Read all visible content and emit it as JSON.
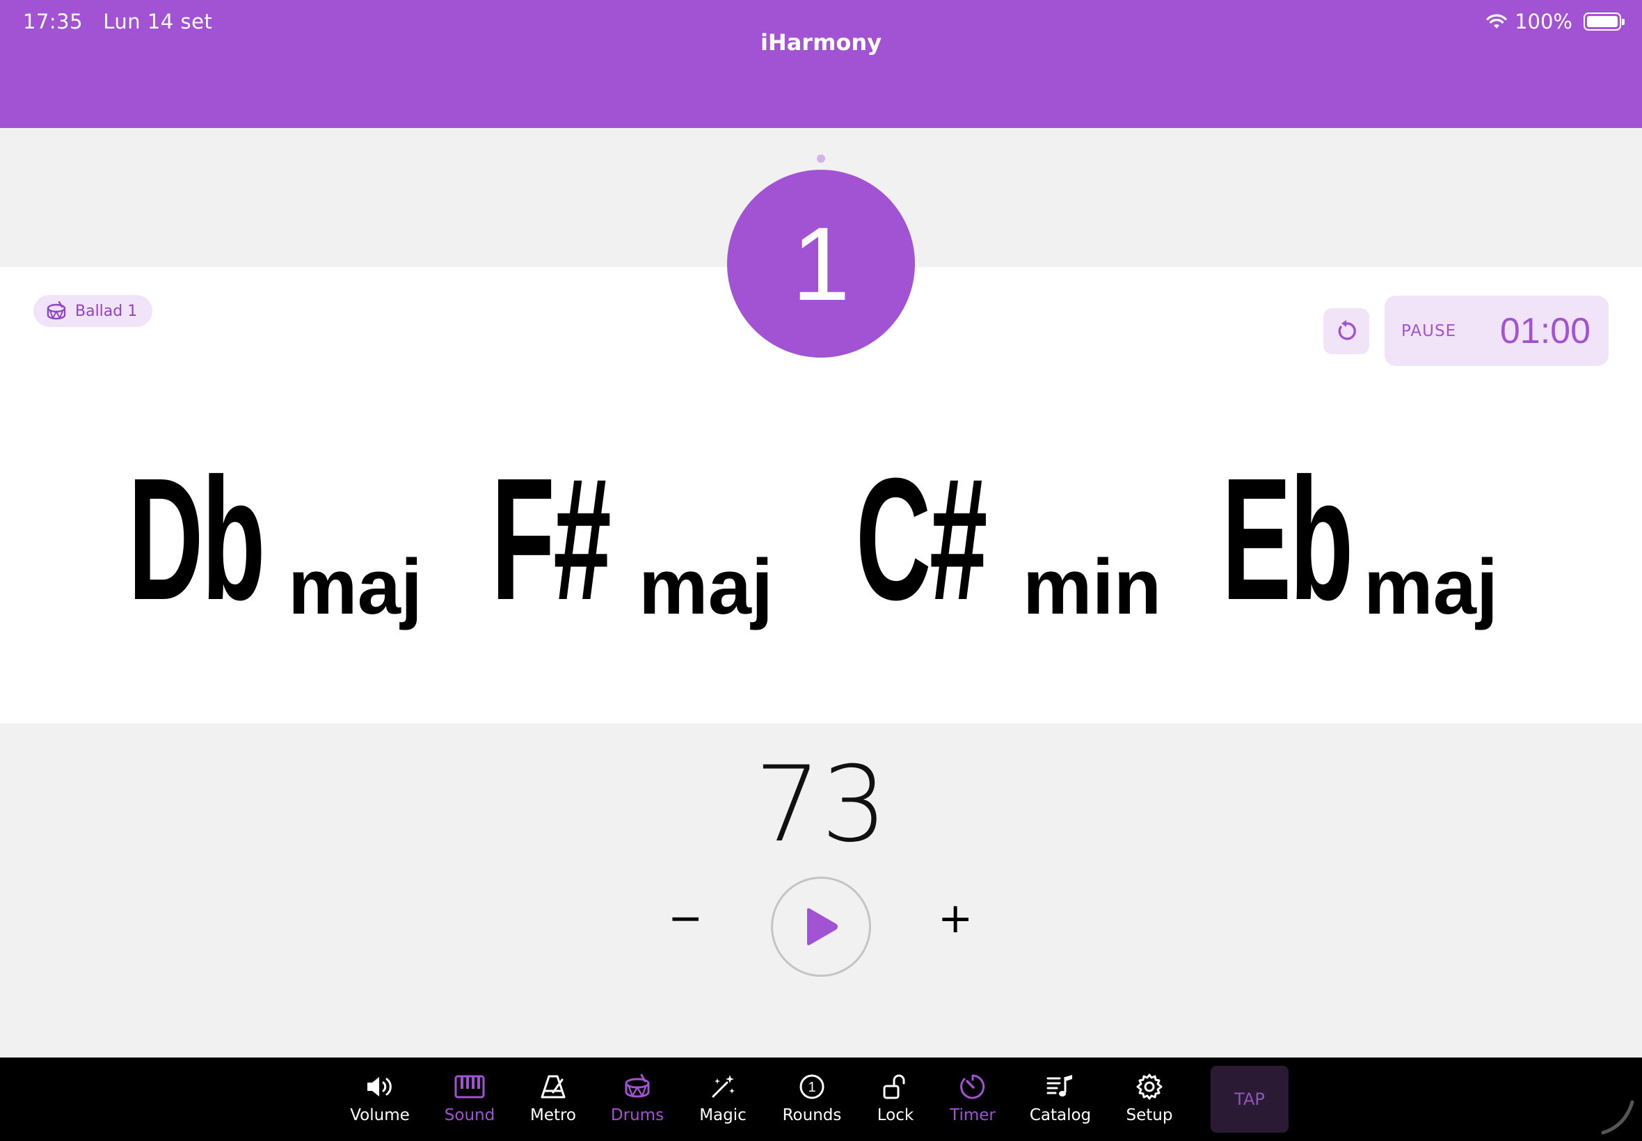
{
  "status": {
    "time": "17:35",
    "date": "Lun 14 set",
    "battery": "100%"
  },
  "app": {
    "title": "iHarmony"
  },
  "beat": {
    "number": "1"
  },
  "pattern": {
    "label": "Ballad 1"
  },
  "timer": {
    "pause_label": "PAUSE",
    "value": "01:00"
  },
  "chords": [
    {
      "root": "Db",
      "quality": "maj"
    },
    {
      "root": "F#",
      "quality": "maj"
    },
    {
      "root": "C#",
      "quality": "min"
    },
    {
      "root": "Eb",
      "quality": "maj"
    }
  ],
  "tempo": {
    "value": "73",
    "minus": "−",
    "plus": "+"
  },
  "toolbar": {
    "items": [
      {
        "label": "Volume",
        "icon": "speaker-icon"
      },
      {
        "label": "Sound",
        "icon": "piano-icon"
      },
      {
        "label": "Metro",
        "icon": "metronome-icon"
      },
      {
        "label": "Drums",
        "icon": "drum-icon"
      },
      {
        "label": "Magic",
        "icon": "magic-wand-icon"
      },
      {
        "label": "Rounds",
        "icon": "rounds-icon"
      },
      {
        "label": "Lock",
        "icon": "unlock-icon"
      },
      {
        "label": "Timer",
        "icon": "timer-icon"
      },
      {
        "label": "Catalog",
        "icon": "catalog-icon"
      },
      {
        "label": "Setup",
        "icon": "gear-icon"
      }
    ],
    "tap": "TAP",
    "rounds_badge": "1"
  },
  "colors": {
    "accent": "#a153d3",
    "accent_light": "#f1e4f9",
    "background": "#f1f1f1",
    "toolbar": "#000000"
  }
}
